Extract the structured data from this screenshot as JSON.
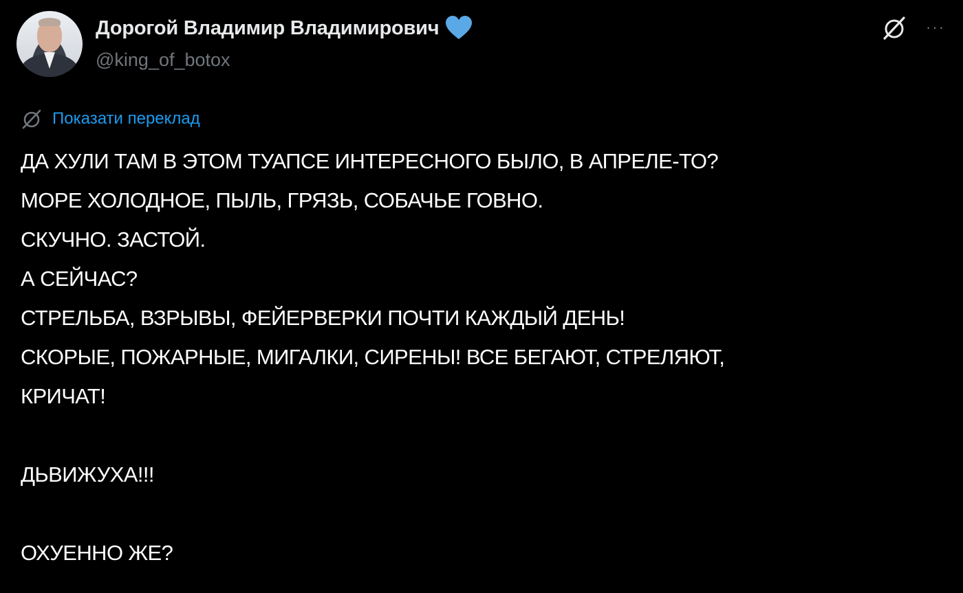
{
  "author": {
    "display_name": "Дорогой Владимир Владимирович",
    "handle": "@king_of_botox",
    "badge_icon": "blue-heart-icon",
    "badge_color": "#5aa9e6"
  },
  "header_actions": {
    "grok_icon": "grok-icon",
    "more_icon": "more-horizontal-icon",
    "more_label": "···"
  },
  "translate": {
    "icon": "translate-icon",
    "label": "Показати переклад",
    "color": "#1d9bf0"
  },
  "body": {
    "lines": [
      "ДА ХУЛИ ТАМ В ЭТОМ ТУАПСЕ ИНТЕРЕСНОГО БЫЛО, В АПРЕЛЕ-ТО?",
      "МОРЕ ХОЛОДНОЕ, ПЫЛЬ, ГРЯЗЬ, СОБАЧЬЕ ГОВНО.",
      "СКУЧНО. ЗАСТОЙ.",
      "А СЕЙЧАС?",
      "СТРЕЛЬБА, ВЗРЫВЫ, ФЕЙЕРВЕРКИ ПОЧТИ КАЖДЫЙ ДЕНЬ!",
      "СКОРЫЕ, ПОЖАРНЫЕ, МИГАЛКИ, СИРЕНЫ! ВСЕ БЕГАЮТ, СТРЕЛЯЮТ,",
      "КРИЧАТ!",
      "",
      "ДЬВИЖУХА!!!",
      "",
      "ОХУЕННО ЖЕ?"
    ]
  },
  "theme": {
    "background": "#000000",
    "text": "#ffffff",
    "secondary_text": "#71767b"
  }
}
